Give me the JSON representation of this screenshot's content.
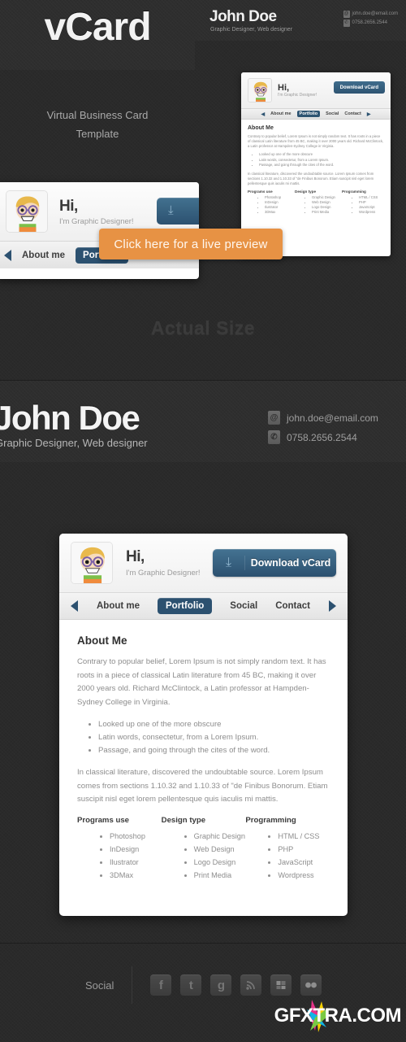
{
  "hero": {
    "title": "vCard",
    "subtitle_line1": "Virtual Business Card",
    "subtitle_line2": "Template"
  },
  "live_preview": {
    "label": "Click  here for a live preview",
    "color": "#e79244"
  },
  "actual_size_label": "Actual Size",
  "profile": {
    "name": "John Doe",
    "role": "Graphic Designer, Web designer",
    "email": "john.doe@email.com",
    "phone": "0758.2656.2544",
    "email_icon": "at-sign-icon",
    "phone_icon": "phone-icon"
  },
  "card": {
    "greeting": "Hi,",
    "greeting_sub": "I'm Graphic Designer!",
    "download_label": "Download vCard",
    "download_icon": "download-icon",
    "avatar_icon": "avatar-boy-glasses",
    "nav": {
      "prev_icon": "arrow-left-icon",
      "next_icon": "arrow-right-icon",
      "items": [
        {
          "label": "About me",
          "active": false
        },
        {
          "label": "Portfolio",
          "active": true
        },
        {
          "label": "Social",
          "active": false
        },
        {
          "label": "Contact",
          "active": false
        }
      ]
    },
    "about": {
      "heading": "About Me",
      "paragraph1": "Contrary to popular belief, Lorem Ipsum is not simply random text. It has roots in a piece of classical Latin literature from 45 BC, making it over 2000 years old. Richard McClintock, a Latin professor at Hampden-Sydney College in Virginia.",
      "bullets": [
        "Looked up one of the more obscure",
        "Latin words, consectetur, from a Lorem Ipsum.",
        "Passage, and going through the cites of the word."
      ],
      "paragraph2": "In classical literature, discovered the undoubtable source. Lorem Ipsum comes from sections 1.10.32 and 1.10.33 of \"de Finibus Bonorum. Etiam suscipit nisl eget lorem pellentesque quis iaculis mi mattis."
    },
    "columns": [
      {
        "heading": "Programs use",
        "items": [
          "Photoshop",
          "InDesign",
          "Ilustrator",
          "3DMax"
        ]
      },
      {
        "heading": "Design type",
        "items": [
          "Graphic Design",
          "Web Design",
          "Logo Design",
          "Print Media"
        ]
      },
      {
        "heading": "Programming",
        "items": [
          "HTML / CSS",
          "PHP",
          "JavaScript",
          "Wordpress"
        ]
      }
    ]
  },
  "footer": {
    "social_label": "Social",
    "social_icons": [
      {
        "name": "facebook-icon",
        "glyph": "f"
      },
      {
        "name": "twitter-icon",
        "glyph": "t"
      },
      {
        "name": "google-icon",
        "glyph": "g"
      },
      {
        "name": "rss-icon",
        "glyph": "◜"
      },
      {
        "name": "flickr-icon",
        "glyph": "▒"
      },
      {
        "name": "dribbble-icon",
        "glyph": "●●"
      }
    ],
    "watermark": "GFXTRA.COM"
  },
  "theme": {
    "accent_blue": "#2c5170",
    "orange": "#e79244",
    "dark_bg": "#2e2e2e",
    "card_bg": "#ffffff"
  }
}
